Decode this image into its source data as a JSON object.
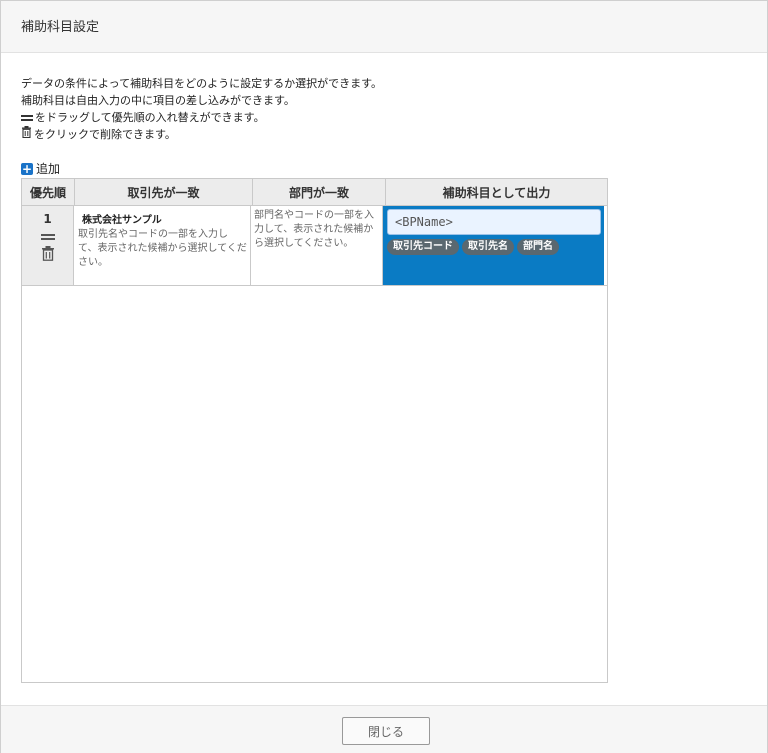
{
  "dialog": {
    "title": "補助科目設定"
  },
  "description": {
    "line1": "データの条件によって補助科目をどのように設定するか選択ができます。",
    "line2": "補助科目は自由入力の中に項目の差し込みができます。",
    "line3": "をドラッグして優先順の入れ替えができます。",
    "line4": "をクリックで削除できます。"
  },
  "add_label": "追加",
  "table": {
    "headers": {
      "priority": "優先順",
      "partner": "取引先が一致",
      "department": "部門が一致",
      "output": "補助科目として出力"
    },
    "rows": [
      {
        "priority": "1",
        "partner_name": "株式会社サンプル",
        "partner_hint": "取引先名やコードの一部を入力して、表示された候補から選択してください。",
        "department_hint": "部門名やコードの一部を入力して、表示された候補から選択してください。",
        "output_value": "<BPName>",
        "chips": [
          "取引先コード",
          "取引先名",
          "部門名"
        ]
      }
    ]
  },
  "footer": {
    "close_label": "閉じる"
  },
  "colors": {
    "accent": "#0a7bc4",
    "add_icon": "#1a73c8",
    "chip": "#5a6870",
    "header_bg": "#f6f6f6"
  },
  "icons": {
    "drag": "drag-handle-icon",
    "trash": "trash-icon",
    "add": "plus-icon"
  }
}
